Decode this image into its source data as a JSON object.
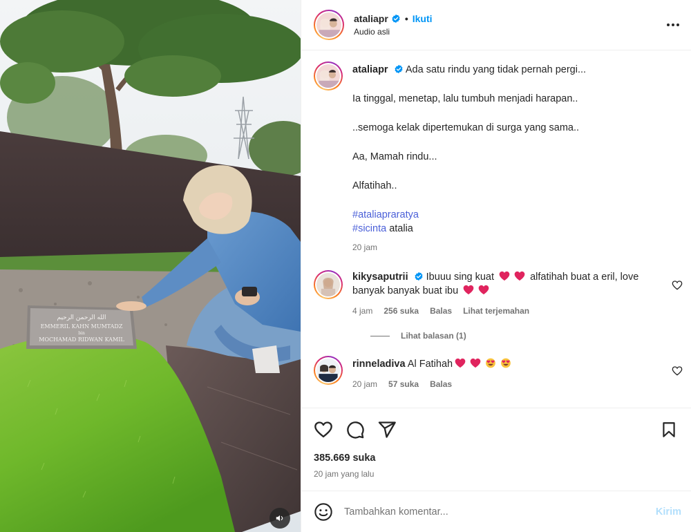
{
  "post": {
    "username": "ataliapr",
    "follow_label": "Ikuti",
    "audio_label": "Audio asli",
    "dot": "•"
  },
  "caption": {
    "username": "ataliapr",
    "line1": "Ada satu rindu yang tidak pernah pergi...",
    "line2": "Ia tinggal, menetap, lalu tumbuh menjadi harapan..",
    "line3": "..semoga kelak dipertemukan di surga yang sama..",
    "line4": "Aa, Mamah rindu...",
    "line5": "Alfatihah..",
    "hashtag1": "#ataliapraratya",
    "hashtag2": "#sicinta",
    "hashtag2_suffix": " atalia",
    "time": "20 jam"
  },
  "comments": [
    {
      "username": "kikysaputrii",
      "text_a": "Ibuuu sing kuat",
      "text_b": "alfatihah buat a eril, love banyak banyak buat ibu",
      "time": "4 jam",
      "likes": "256 suka",
      "reply": "Balas",
      "translate": "Lihat terjemahan",
      "view_replies": "Lihat balasan (1)"
    },
    {
      "username": "rinneladiva",
      "text_a": "Al Fatihah",
      "time": "20 jam",
      "likes": "57 suka",
      "reply": "Balas"
    }
  ],
  "engagement": {
    "likes": "385.669 suka",
    "time": "20 jam yang lalu"
  },
  "composer": {
    "placeholder": "Tambahkan komentar...",
    "post_label": "Kirim"
  },
  "tombstone": {
    "line1": "الله الرحمن الرحيم",
    "line2": "EMMERIL KAHN MUMTADZ",
    "line3": "bin",
    "line4": "MOCHAMAD RIDWAN KAMIL"
  },
  "colors": {
    "link": "#0095f6",
    "hashtag": "#4a5fd8",
    "verified": "#0095f6",
    "heart_emoji": "#e0245e",
    "post_disabled": "#b2dffc"
  }
}
